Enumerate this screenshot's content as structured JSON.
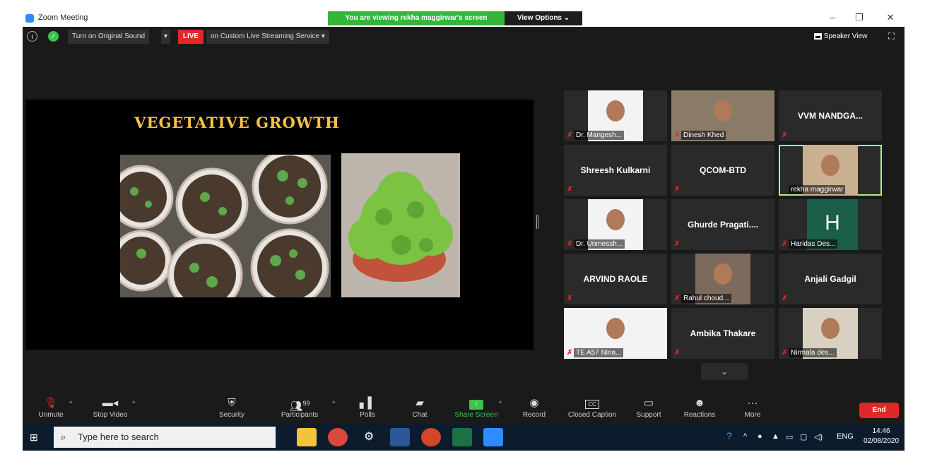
{
  "window": {
    "title": "Zoom Meeting"
  },
  "banner": {
    "viewing": "You are viewing rekha maggirwar's screen",
    "view_options": "View Options ⌄"
  },
  "meetbar": {
    "original_sound": "Turn on Original Sound",
    "live": "LIVE",
    "streaming": "on Custom Live Streaming Service",
    "speaker_view": "Speaker View"
  },
  "slide": {
    "title": "VEGETATIVE GROWTH"
  },
  "participants": [
    {
      "label": "Dr. Mangesh...",
      "video": true
    },
    {
      "label": "Dinesh Khed",
      "video": true
    },
    {
      "label": "VVM NANDGA...",
      "video": false
    },
    {
      "label": "Shreesh Kulkarni",
      "video": false
    },
    {
      "label": "QCOM-BTD",
      "video": false
    },
    {
      "label": "rekha maggirwar",
      "video": true,
      "active": true
    },
    {
      "label": "Dr. Unmessh...",
      "video": true
    },
    {
      "label": "Ghurde Pragati....",
      "video": false
    },
    {
      "label": "Haridas Des...",
      "video": true,
      "initial": "H"
    },
    {
      "label": "ARVIND RAOLE",
      "video": false
    },
    {
      "label": "Rahul choud...",
      "video": true
    },
    {
      "label": "Anjali Gadgil",
      "video": false
    },
    {
      "label": "TE A57 Nina...",
      "video": true
    },
    {
      "label": "Ambika Thakare",
      "video": false
    },
    {
      "label": "Nirmala des...",
      "video": true
    }
  ],
  "toolbar": {
    "unmute": "Unmute",
    "stop_video": "Stop Video",
    "security": "Security",
    "participants": "Participants",
    "participants_count": "99",
    "polls": "Polls",
    "chat": "Chat",
    "share_screen": "Share Screen",
    "record": "Record",
    "closed_caption": "Closed Caption",
    "closed_caption_icon": "CC",
    "support": "Support",
    "reactions": "Reactions",
    "more": "More",
    "end": "End"
  },
  "taskbar": {
    "search_placeholder": "Type here to search",
    "language": "ENG",
    "time": "14:46",
    "date": "02/08/2020"
  },
  "colors": {
    "zoom_blue": "#2d8cff",
    "live_red": "#e02828",
    "share_green": "#3ec14d",
    "active_outline": "#b8e986"
  }
}
